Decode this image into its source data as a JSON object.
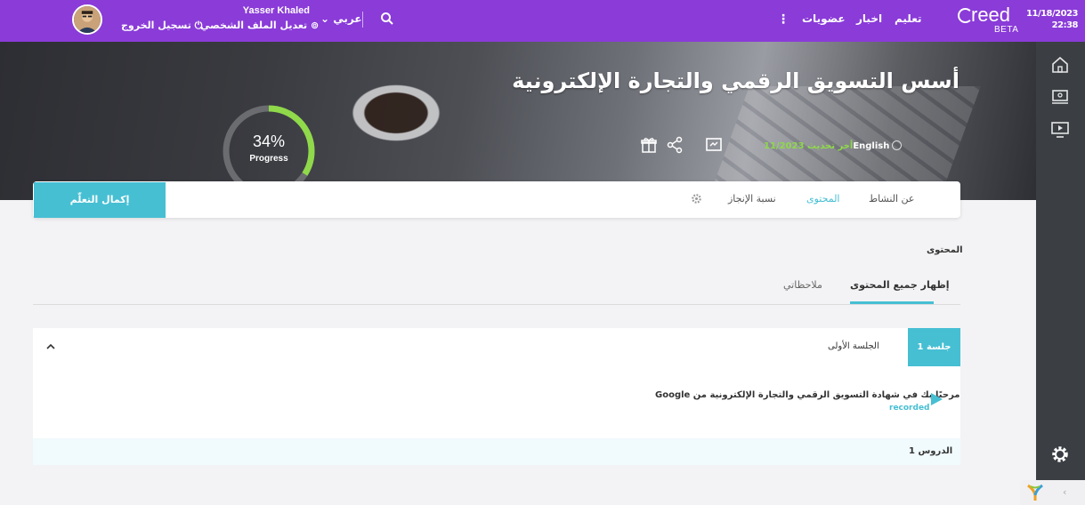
{
  "header": {
    "date": "11/18/2023",
    "time": "22:38",
    "logo_text": "reed",
    "logo_badge": "BETA",
    "nav": [
      "تعليم",
      "اخبار",
      "عضويات"
    ],
    "more_label": "⋮",
    "language": "عربي",
    "user_name": "Yasser Khaled",
    "edit_profile": "تعديل الملف الشخصي",
    "logout": "تسجيل الخروج"
  },
  "hero": {
    "title": "أسس التسويق الرقمي والتجارة الإلكترونية",
    "language_value": "English",
    "updated_label": "أخر تحديث",
    "updated_value": "11/2023",
    "progress_percent": "34%",
    "progress_fraction": 0.34,
    "progress_label": "Progress"
  },
  "tabs": {
    "complete_button": "إكمال التعلّم",
    "items": [
      "عن النشاط",
      "المحتوى",
      "نسبة الإنجاز"
    ]
  },
  "content": {
    "section_title": "المحتوى",
    "subtabs": [
      "إظهار جميع المحتوى",
      "ملاحظاتي"
    ],
    "session": {
      "badge": "جلسة 1",
      "name": "الجلسة الأولى",
      "lesson_title": "مرحبًا بك في شهادة التسويق الرقمي والتجارة الإلكترونية من Google",
      "lesson_type": "recorded",
      "lessons_count": "الدروس 1"
    }
  },
  "colors": {
    "topbar": "#8a3bd8",
    "accent": "#46bfd3",
    "progress": "#8fd94a",
    "sidebar": "#3b3f44"
  }
}
